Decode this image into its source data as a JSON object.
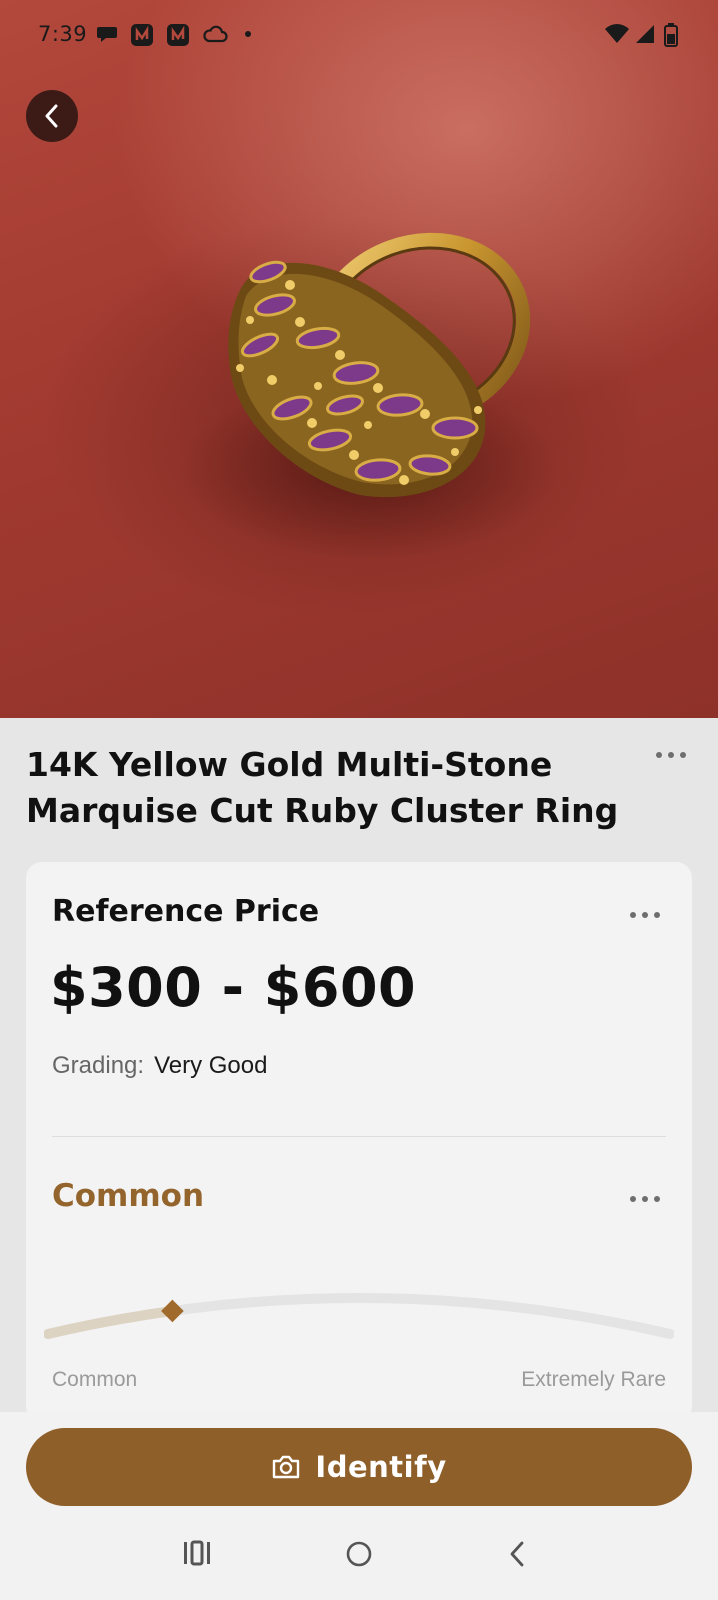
{
  "status_bar": {
    "time": "7:39",
    "left_icons": [
      "chat-bubble-icon",
      "app-n-icon",
      "app-n-icon",
      "cloud-icon",
      "dot-icon"
    ],
    "right_icons": [
      "wifi-icon",
      "cell-signal-icon",
      "battery-icon"
    ]
  },
  "item": {
    "title": "14K Yellow Gold Multi-Stone Marquise Cut Ruby Cluster Ring"
  },
  "reference_price": {
    "label": "Reference Price",
    "value": "$300 - $600",
    "grading_label": "Grading:",
    "grading_value": "Very Good"
  },
  "rarity": {
    "label": "Common",
    "scale_min_label": "Common",
    "scale_max_label": "Extremely Rare",
    "level": 0.2
  },
  "actions": {
    "identify_label": "Identify"
  },
  "colors": {
    "accent": "#8f5f2a",
    "rarity_text": "#93652d",
    "photo_background": "#a33b31"
  }
}
